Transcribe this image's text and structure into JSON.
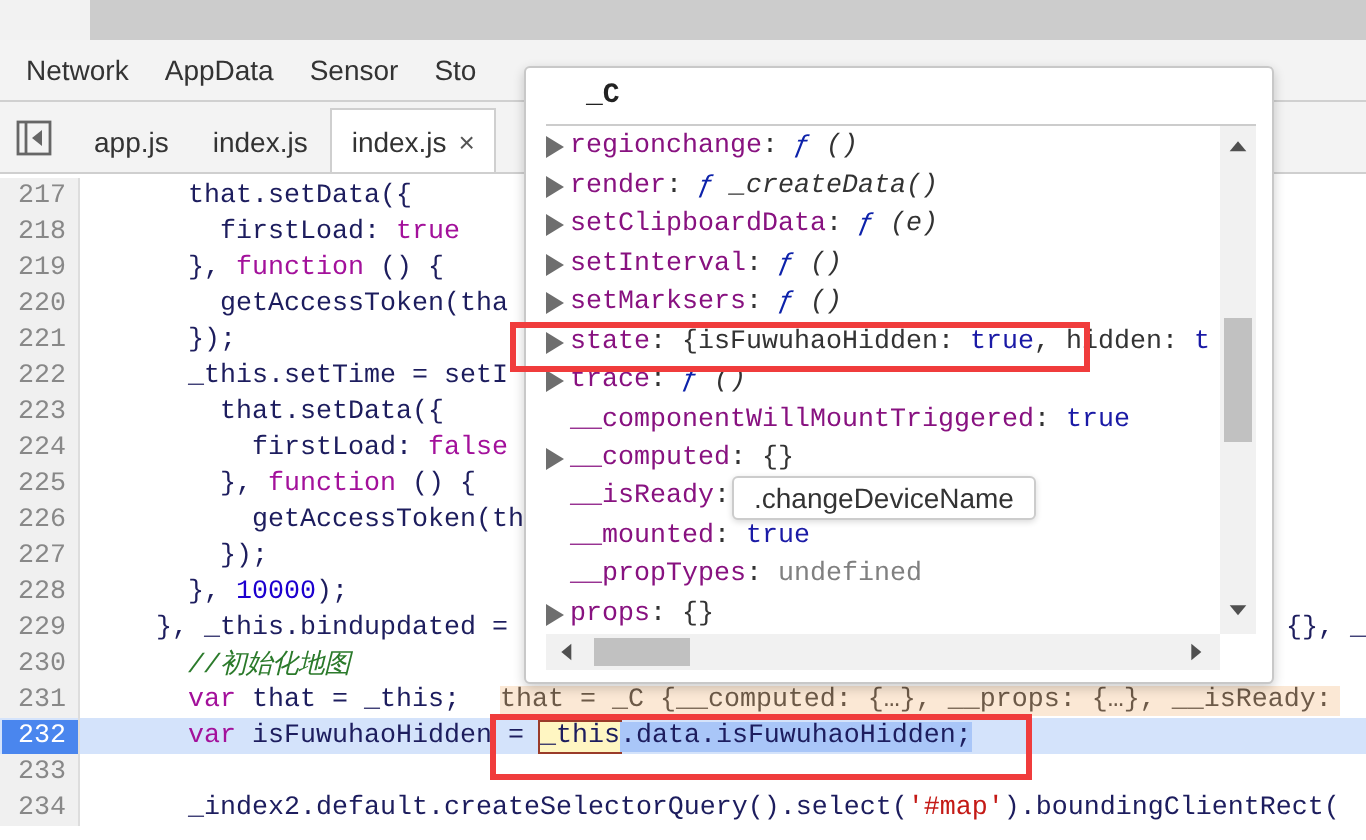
{
  "tool_tabs": [
    {
      "label": "Network"
    },
    {
      "label": "AppData"
    },
    {
      "label": "Sensor"
    },
    {
      "label": "Sto"
    }
  ],
  "file_tabs": [
    {
      "label": "app.js",
      "selected": false
    },
    {
      "label": "index.js",
      "selected": false
    },
    {
      "label": "index.js",
      "selected": true,
      "close": "×"
    }
  ],
  "code_lines": [
    {
      "number": "217",
      "current": false,
      "tokens": [
        {
          "text": "      that.setData({",
          "kind": "plain"
        }
      ]
    },
    {
      "number": "218",
      "current": false,
      "tokens": [
        {
          "text": "        firstLoad: ",
          "kind": "plain"
        },
        {
          "text": "true",
          "kind": "literal"
        }
      ]
    },
    {
      "number": "219",
      "current": false,
      "tokens": [
        {
          "text": "      }, ",
          "kind": "plain"
        },
        {
          "text": "function",
          "kind": "keyword"
        },
        {
          "text": " () {",
          "kind": "plain"
        }
      ]
    },
    {
      "number": "220",
      "current": false,
      "tokens": [
        {
          "text": "        getAccessToken(tha",
          "kind": "plain"
        }
      ]
    },
    {
      "number": "221",
      "current": false,
      "tokens": [
        {
          "text": "      });",
          "kind": "plain"
        }
      ]
    },
    {
      "number": "222",
      "current": false,
      "tokens": [
        {
          "text": "      _this.setTime = setI",
          "kind": "plain"
        }
      ]
    },
    {
      "number": "223",
      "current": false,
      "tokens": [
        {
          "text": "        that.setData({",
          "kind": "plain"
        }
      ]
    },
    {
      "number": "224",
      "current": false,
      "tokens": [
        {
          "text": "          firstLoad: ",
          "kind": "plain"
        },
        {
          "text": "false",
          "kind": "literal"
        }
      ]
    },
    {
      "number": "225",
      "current": false,
      "tokens": [
        {
          "text": "        }, ",
          "kind": "plain"
        },
        {
          "text": "function",
          "kind": "keyword"
        },
        {
          "text": " () {",
          "kind": "plain"
        }
      ]
    },
    {
      "number": "226",
      "current": false,
      "tokens": [
        {
          "text": "          getAccessToken(th",
          "kind": "plain"
        }
      ]
    },
    {
      "number": "227",
      "current": false,
      "tokens": [
        {
          "text": "        });",
          "kind": "plain"
        }
      ]
    },
    {
      "number": "228",
      "current": false,
      "tokens": [
        {
          "text": "      }, ",
          "kind": "plain"
        },
        {
          "text": "10000",
          "kind": "number"
        },
        {
          "text": ");",
          "kind": "plain"
        }
      ]
    },
    {
      "number": "229",
      "current": false,
      "tokens": [
        {
          "text": "    }, _this.bindupdated = ",
          "kind": "plain"
        }
      ],
      "right_text": "{}, _"
    },
    {
      "number": "230",
      "current": false,
      "tokens": [
        {
          "text": "      //初始化地图",
          "kind": "comment"
        }
      ]
    },
    {
      "number": "231",
      "current": false,
      "tokens": [
        {
          "text": "      var",
          "kind": "keyword"
        },
        {
          "text": " that = _this;",
          "kind": "plain"
        }
      ],
      "inline_value": "that = _C {__computed: {…}, __props: {…}, __isReady:"
    },
    {
      "number": "232",
      "current": true,
      "tokens": [
        {
          "text": "      var",
          "kind": "keyword"
        },
        {
          "text": " isFuwuhaoHidden = ",
          "kind": "plain"
        },
        {
          "text": "_this",
          "kind": "hover"
        },
        {
          "text": ".data.isFuwuhaoHidden;",
          "kind": "selected"
        }
      ]
    },
    {
      "number": "233",
      "current": false
    },
    {
      "number": "234",
      "current": false,
      "tokens": [
        {
          "text": "      _index2.default.createSelectorQuery().select(",
          "kind": "plain"
        },
        {
          "text": "'#map'",
          "kind": "string"
        },
        {
          "text": ").boundingClientRect(",
          "kind": "plain"
        }
      ]
    }
  ],
  "popover": {
    "title": "_C",
    "tooltip": ".changeDeviceName",
    "properties": [
      {
        "key": "regionchange",
        "expandable": true,
        "sep": ":",
        "value": [
          {
            "text": "ƒ",
            "kind": "f"
          },
          {
            "text": " ()",
            "kind": "sig"
          }
        ]
      },
      {
        "key": "render",
        "expandable": true,
        "sep": ":",
        "value": [
          {
            "text": "ƒ",
            "kind": "f"
          },
          {
            "text": " _createData()",
            "kind": "sig"
          }
        ]
      },
      {
        "key": "setClipboardData",
        "expandable": true,
        "sep": ":",
        "value": [
          {
            "text": "ƒ",
            "kind": "f"
          },
          {
            "text": " (e)",
            "kind": "sig"
          }
        ]
      },
      {
        "key": "setInterval",
        "expandable": true,
        "sep": ":",
        "value": [
          {
            "text": "ƒ",
            "kind": "f"
          },
          {
            "text": " ()",
            "kind": "sig"
          }
        ]
      },
      {
        "key": "setMarksers",
        "expandable": true,
        "sep": ":",
        "value": [
          {
            "text": "ƒ",
            "kind": "f"
          },
          {
            "text": " ()",
            "kind": "sig"
          }
        ]
      },
      {
        "key": "state",
        "expandable": true,
        "sep": ":",
        "value": [
          {
            "text": "{isFuwuhaoHidden: ",
            "kind": "obj"
          },
          {
            "text": "true",
            "kind": "bool"
          },
          {
            "text": ", hidden: ",
            "kind": "obj"
          },
          {
            "text": "t",
            "kind": "bool"
          }
        ]
      },
      {
        "key": "trace",
        "expandable": true,
        "sep": ":",
        "value": [
          {
            "text": "ƒ",
            "kind": "f"
          },
          {
            "text": " ()",
            "kind": "sig"
          }
        ]
      },
      {
        "key": "__componentWillMountTriggered",
        "expandable": false,
        "sep": ":",
        "value": [
          {
            "text": "true",
            "kind": "bool"
          }
        ]
      },
      {
        "key": "__computed",
        "expandable": true,
        "sep": ":",
        "value": [
          {
            "text": "{}",
            "kind": "obj"
          }
        ]
      },
      {
        "key": "__isReady",
        "expandable": false,
        "sep": ":"
      },
      {
        "key": "__mounted",
        "expandable": false,
        "sep": ":",
        "value": [
          {
            "text": "true",
            "kind": "bool"
          }
        ]
      },
      {
        "key": "__propTypes",
        "expandable": false,
        "sep": ":",
        "value": [
          {
            "text": "undefined",
            "kind": "undef"
          }
        ]
      },
      {
        "key": "props",
        "expandable": true,
        "sep": ":",
        "value": [
          {
            "text": "{}",
            "kind": "obj"
          }
        ]
      }
    ]
  }
}
